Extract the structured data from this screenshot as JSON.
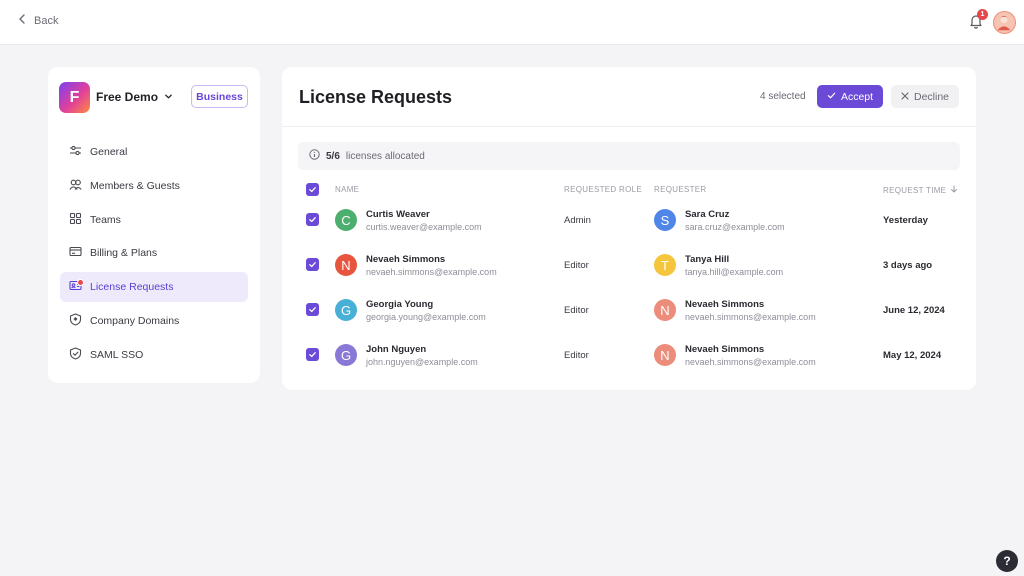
{
  "topbar": {
    "back_label": "Back",
    "notification_count": "1"
  },
  "sidebar": {
    "logo_letter": "F",
    "workspace_name": "Free Demo",
    "plan_badge": "Business",
    "items": [
      {
        "label": "General",
        "icon": "sliders-icon"
      },
      {
        "label": "Members & Guests",
        "icon": "users-icon"
      },
      {
        "label": "Teams",
        "icon": "grid-icon"
      },
      {
        "label": "Billing & Plans",
        "icon": "credit-card-icon"
      },
      {
        "label": "License Requests",
        "icon": "id-card-icon",
        "active": true,
        "badge_dot": true
      },
      {
        "label": "Company Domains",
        "icon": "shield-icon"
      },
      {
        "label": "SAML SSO",
        "icon": "shield-check-icon"
      }
    ]
  },
  "panel": {
    "title": "License Requests",
    "selected_text": "4 selected",
    "accept_label": "Accept",
    "decline_label": "Decline",
    "allocation": {
      "count": "5/6",
      "text": "licenses allocated"
    }
  },
  "table": {
    "headers": {
      "name": "NAME",
      "role": "REQUESTED ROLE",
      "requester": "REQUESTER",
      "time": "REQUEST TIME"
    },
    "rows": [
      {
        "checked": true,
        "name": "Curtis Weaver",
        "email": "curtis.weaver@example.com",
        "initial": "C",
        "color": "#4caf6e",
        "role": "Admin",
        "requester": "Sara Cruz",
        "requester_email": "sara.cruz@example.com",
        "requester_initial": "S",
        "requester_color": "#4f86e8",
        "time": "Yesterday"
      },
      {
        "checked": true,
        "name": "Nevaeh Simmons",
        "email": "nevaeh.simmons@example.com",
        "initial": "N",
        "color": "#e8553f",
        "role": "Editor",
        "requester": "Tanya Hill",
        "requester_email": "tanya.hill@example.com",
        "requester_initial": "T",
        "requester_color": "#f5c53c",
        "time": "3 days ago"
      },
      {
        "checked": true,
        "name": "Georgia Young",
        "email": "georgia.young@example.com",
        "initial": "G",
        "color": "#48b0d6",
        "role": "Editor",
        "requester": "Nevaeh Simmons",
        "requester_email": "nevaeh.simmons@example.com",
        "requester_initial": "N",
        "requester_color": "#ec8c7a",
        "time": "June 12, 2024"
      },
      {
        "checked": true,
        "name": "John Nguyen",
        "email": "john.nguyen@example.com",
        "initial": "G",
        "color": "#8a78d6",
        "role": "Editor",
        "requester": "Nevaeh Simmons",
        "requester_email": "nevaeh.simmons@example.com",
        "requester_initial": "N",
        "requester_color": "#ec8c7a",
        "time": "May 12, 2024"
      }
    ]
  },
  "help_label": "?",
  "colors": {
    "accent": "#6a4ad6",
    "background": "#f4f4f6",
    "badge_red": "#e5484d"
  }
}
